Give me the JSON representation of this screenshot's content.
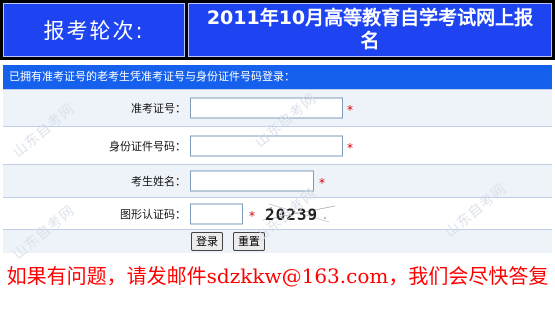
{
  "header": {
    "left_label": "报考轮次:",
    "right_title": "2011年10月高等教育自学考试网上报名"
  },
  "form": {
    "title": "已拥有准考证号的老考生凭准考证号与身份证件号码登录：",
    "fields": [
      {
        "label": "准考证号：",
        "value": "",
        "required_mark": "*"
      },
      {
        "label": "身份证件号码：",
        "value": "",
        "required_mark": "*"
      },
      {
        "label": "考生姓名：",
        "value": "",
        "required_mark": "*"
      },
      {
        "label": "图形认证码：",
        "value": "",
        "required_mark": "*"
      }
    ],
    "captcha_text": "20239",
    "login_button": "登录",
    "reset_button": "重置"
  },
  "notice": "如果有问题，请发邮件sdzkkw@163.com，我们会尽快答复",
  "watermark": "山东自考网",
  "colors": {
    "header_bg": "#1d44f0",
    "form_title_bg": "#1660ee",
    "required": "#d40000",
    "notice": "#ff0000"
  }
}
